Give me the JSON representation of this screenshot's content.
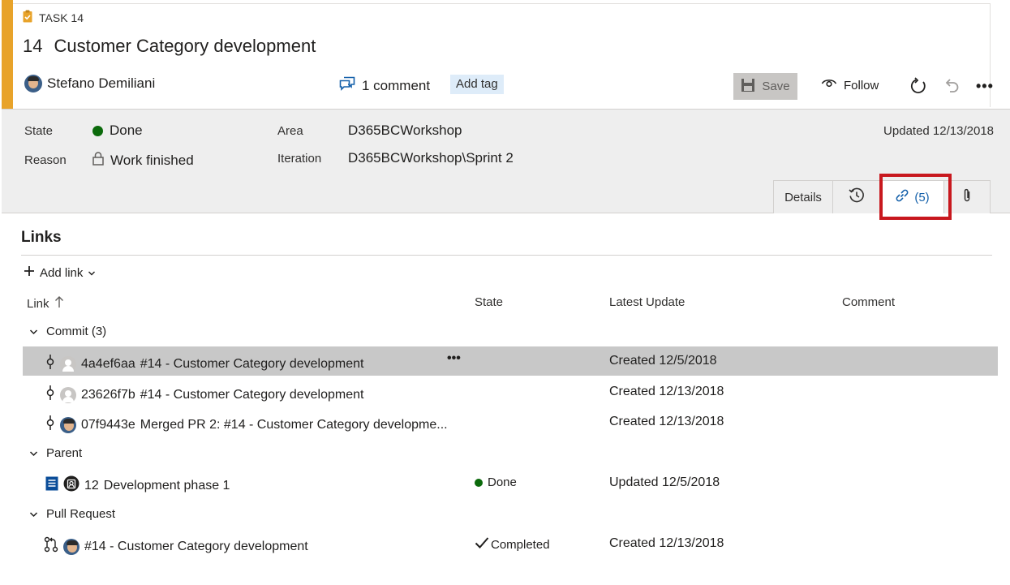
{
  "task": {
    "type_label": "TASK 14",
    "id": "14",
    "title": "Customer Category development",
    "assignee": "Stefano Demiliani"
  },
  "toolbar": {
    "comments_label": "1 comment",
    "add_tag_label": "Add tag",
    "save_label": "Save",
    "follow_label": "Follow",
    "more_label": "•••"
  },
  "fields": {
    "state_label": "State",
    "state_value": "Done",
    "reason_label": "Reason",
    "reason_value": "Work finished",
    "area_label": "Area",
    "area_value": "D365BCWorkshop",
    "iteration_label": "Iteration",
    "iteration_value": "D365BCWorkshop\\Sprint 2",
    "updated": "Updated 12/13/2018"
  },
  "tabs": {
    "details_label": "Details",
    "links_count": "(5)"
  },
  "links": {
    "title": "Links",
    "add_link_label": "Add link",
    "columns": {
      "link": "Link",
      "state": "State",
      "latest_update": "Latest Update",
      "comment": "Comment"
    },
    "groups": {
      "commit": "Commit (3)",
      "parent": "Parent",
      "pull_request": "Pull Request"
    },
    "rows": [
      {
        "hash": "4a4ef6aa",
        "text": "#14 - Customer Category development",
        "state": "",
        "update": "Created 12/5/2018",
        "actions": "•••"
      },
      {
        "hash": "23626f7b",
        "text": "#14 - Customer Category development",
        "state": "",
        "update": "Created 12/13/2018"
      },
      {
        "hash": "07f9443e",
        "text": "Merged PR 2: #14 - Customer Category developme...",
        "state": "",
        "update": "Created 12/13/2018"
      },
      {
        "hash": "12",
        "text": "Development phase 1",
        "state": "Done",
        "update": "Updated 12/5/2018"
      },
      {
        "hash": "",
        "text": "#14 - Customer Category development",
        "state": "Completed",
        "update": "Created 12/13/2018"
      }
    ]
  },
  "colors": {
    "accent": "#e8a32a",
    "done_green": "#0b6a0b",
    "link_blue": "#1460aa",
    "highlight_red": "#c8181e",
    "selected_row": "#c8c8c8"
  }
}
